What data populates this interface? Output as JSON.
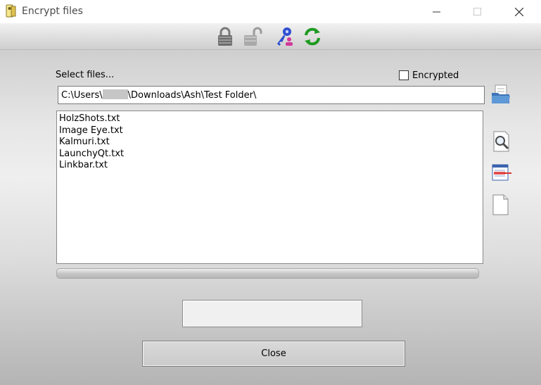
{
  "window": {
    "title": "Encrypt files",
    "controls": [
      "minimize-icon",
      "maximize-icon",
      "close-icon"
    ]
  },
  "toolbar": {
    "icons": [
      "padlock-locked-icon",
      "padlock-open-icon",
      "key-user-icon",
      "refresh-icon"
    ]
  },
  "form": {
    "select_label": "Select files...",
    "encrypted_label": "Encrypted",
    "encrypted_checked": false,
    "path_prefix": "C:\\Users\\",
    "path_suffix": "\\Downloads\\Ash\\Test Folder\\"
  },
  "files": [
    "HolzShots.txt",
    "Image Eye.txt",
    "Kalmuri.txt",
    "LaunchyQt.txt",
    "Linkbar.txt"
  ],
  "side_buttons": [
    "open-folder-icon",
    "search-icon",
    "remove-list-icon",
    "blank-file-icon"
  ],
  "progress": {
    "value": 0
  },
  "status": {
    "text": ""
  },
  "buttons": {
    "close_label": "Close"
  }
}
